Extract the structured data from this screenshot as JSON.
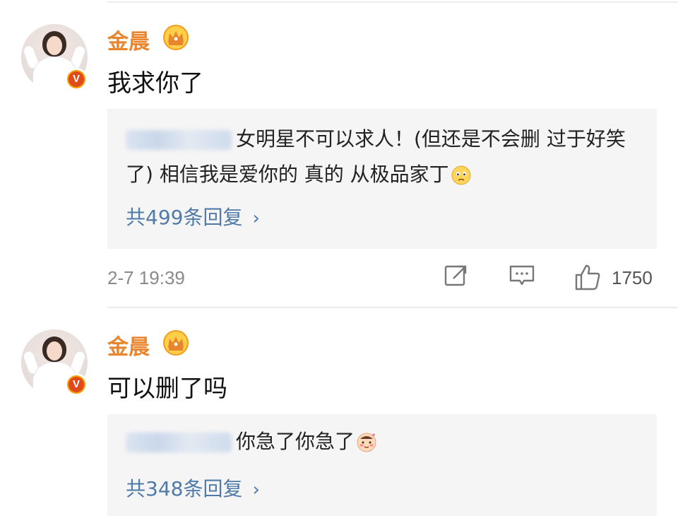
{
  "comments": [
    {
      "username": "金晨",
      "verified_badge": "V",
      "content": "我求你了",
      "reply_preview": "女明星不可以求人！(但还是不会删 过于好笑了) 相信我是爱你的 真的 从极品家丁",
      "reply_count": "共499条回复",
      "timestamp": "2-7 19:39",
      "likes": "1750"
    },
    {
      "username": "金晨",
      "verified_badge": "V",
      "content": "可以删了吗",
      "reply_preview": "你急了你急了",
      "reply_count": "共348条回复"
    }
  ],
  "icons": {
    "crown": "crown-icon",
    "share": "share-icon",
    "comment": "comment-icon",
    "like": "thumbs-up-icon",
    "chevron": "chevron-right-icon"
  },
  "colors": {
    "username": "#e8852d",
    "reply_count": "#507aa8",
    "reply_bg": "#f5f5f5",
    "badge_outer": "#f7a000",
    "badge_inner": "#e04a1a"
  }
}
